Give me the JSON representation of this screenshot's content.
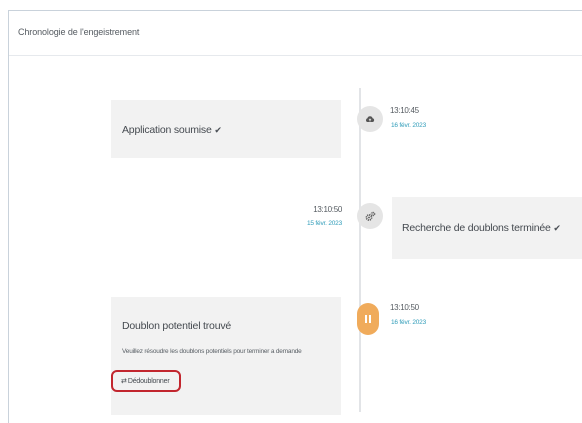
{
  "panel": {
    "title": "Chronologie de l'engeistrement"
  },
  "events": [
    {
      "title": "Application soumise",
      "status_icon": "checkmark",
      "time": "13:10:45",
      "date": "16 févr. 2023",
      "node_icon": "cloud-upload-icon"
    },
    {
      "title": "Recherche de doublons terminée",
      "status_icon": "checkmark",
      "time": "13:10:50",
      "date": "15 févr. 2023",
      "node_icon": "gears-icon"
    },
    {
      "title": "Doublon potentiel trouvé",
      "message": "Veuillez résoudre les doublons potentiels pour terminer a demande",
      "time": "13:10:50",
      "date": "16 févr. 2023",
      "node_icon": "pause-icon",
      "action": {
        "icon": "⇄",
        "label": "Dédoublonner"
      }
    }
  ],
  "colors": {
    "accent_teal": "#2f9cb9",
    "pending_orange": "#f0ab5b",
    "highlight_red": "#c2262e",
    "card_bg": "#f2f2f2"
  }
}
